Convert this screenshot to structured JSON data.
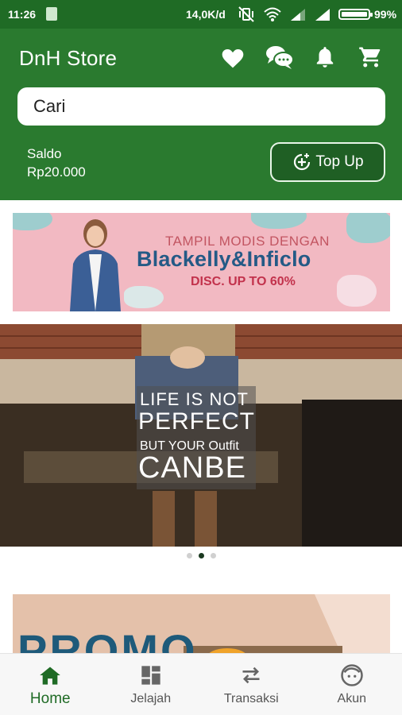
{
  "status_bar": {
    "time": "11:26",
    "network_speed": "14,0K/d",
    "battery": "99%",
    "battery_level": 0.99
  },
  "header": {
    "title": "DnH Store",
    "icons": [
      "heart-icon",
      "chat-icon",
      "bell-icon",
      "cart-icon"
    ],
    "search_placeholder": "Cari",
    "balance_label": "Saldo",
    "balance_value": "Rp20.000",
    "topup_label": "Top Up"
  },
  "banner_promo": {
    "tagline": "TAMPIL MODIS DENGAN",
    "brand": "Blackelly&Inficlo",
    "discount": "DISC. UP TO 60%"
  },
  "hero": {
    "line1": "LIFE IS NOT",
    "line2": "PERFECT",
    "line3": "BUT YOUR Outfit",
    "line4": "CANBE"
  },
  "carousel": {
    "count": 3,
    "active_index": 1
  },
  "promo_section": {
    "word": "PROMO"
  },
  "bottom_nav": [
    {
      "label": "Home",
      "icon": "home-icon",
      "active": true
    },
    {
      "label": "Jelajah",
      "icon": "grid-icon",
      "active": false
    },
    {
      "label": "Transaksi",
      "icon": "transfer-icon",
      "active": false
    },
    {
      "label": "Akun",
      "icon": "face-icon",
      "active": false
    }
  ],
  "colors": {
    "primary": "#2a7a2f",
    "status_bar": "#1f6b25",
    "topup_bg": "#1f5f24",
    "nav_active": "#1f6b25"
  }
}
